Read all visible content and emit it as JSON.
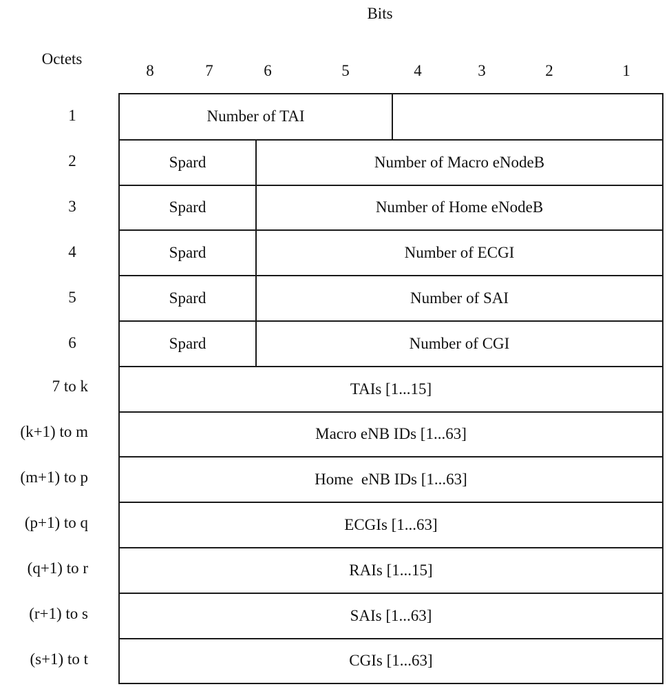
{
  "header": {
    "bits_title": "Bits",
    "octets_title": "Octets",
    "bit_numbers": [
      "8",
      "7",
      "6",
      "5",
      "4",
      "3",
      "2",
      "1"
    ]
  },
  "rows": [
    {
      "octet": "1",
      "cells": [
        "Number of TAI",
        ""
      ]
    },
    {
      "octet": "2",
      "cells": [
        "Spard",
        "Number of Macro eNodeB"
      ]
    },
    {
      "octet": "3",
      "cells": [
        "Spard",
        "Number of Home eNodeB"
      ]
    },
    {
      "octet": "4",
      "cells": [
        "Spard",
        "Number of ECGI"
      ]
    },
    {
      "octet": "5",
      "cells": [
        "Spard",
        "Number of SAI"
      ]
    },
    {
      "octet": "6",
      "cells": [
        "Spard",
        "Number of CGI"
      ]
    },
    {
      "octet": "7 to k",
      "cells": [
        "TAIs [1...15]"
      ]
    },
    {
      "octet": "(k+1) to m",
      "cells": [
        "Macro eNB IDs [1...63]"
      ]
    },
    {
      "octet": "(m+1) to p",
      "cells": [
        "Home  eNB IDs [1...63]"
      ]
    },
    {
      "octet": "(p+1) to q",
      "cells": [
        "ECGIs [1...63]"
      ]
    },
    {
      "octet": "(q+1) to r",
      "cells": [
        "RAIs [1...15]"
      ]
    },
    {
      "octet": "(r+1) to s",
      "cells": [
        "SAIs [1...63]"
      ]
    },
    {
      "octet": "(s+1) to t",
      "cells": [
        "CGIs [1...63]"
      ]
    }
  ]
}
